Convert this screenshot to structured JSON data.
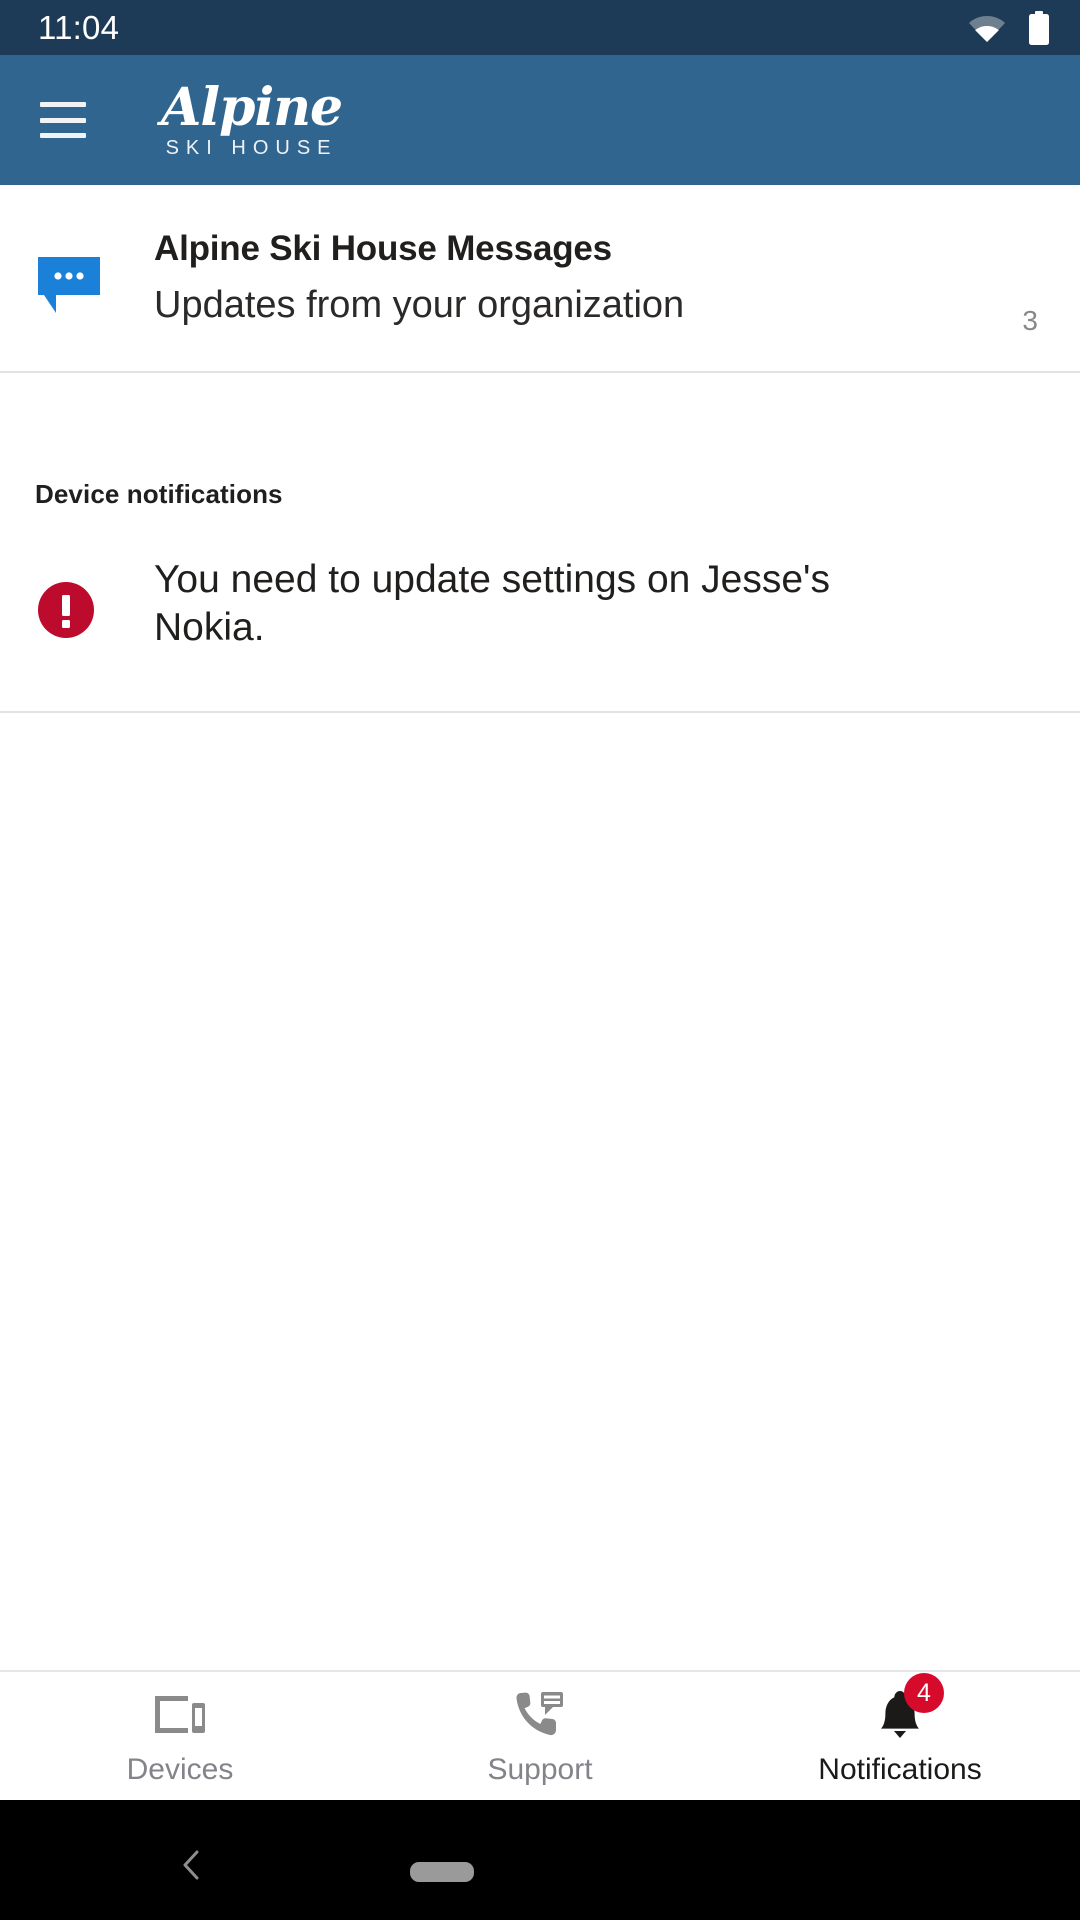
{
  "status_bar": {
    "clock": "11:04",
    "icons": [
      "wifi-icon",
      "battery-icon"
    ],
    "background_color": "#1d3b56"
  },
  "app_bar": {
    "menu_icon": "hamburger-menu-icon",
    "brand_name": "Alpine",
    "brand_subtitle": "SKI HOUSE",
    "background_color": "#30658f"
  },
  "messages_card": {
    "icon": "message-bubble-icon",
    "icon_color": "#1b81d8",
    "title": "Alpine Ski House Messages",
    "subtitle": "Updates from your organization",
    "count": "3"
  },
  "device_notifications": {
    "section_title": "Device notifications",
    "items": [
      {
        "icon": "alert-error-icon",
        "icon_color": "#bd0b2d",
        "text": "You need to update settings on Jesse's Nokia."
      }
    ]
  },
  "bottom_nav": {
    "tabs": [
      {
        "label": "Devices",
        "icon": "devices-tablet-phone-icon",
        "active": "false",
        "badge": ""
      },
      {
        "label": "Support",
        "icon": "support-phone-icon",
        "active": "false",
        "badge": ""
      },
      {
        "label": "Notifications",
        "icon": "bell-icon",
        "active": "true",
        "badge": "4"
      }
    ],
    "badge_color": "#d60b2b",
    "active_color": "#1b1a19",
    "inactive_color": "#84838a"
  },
  "system_nav": {
    "back_icon": "chevron-left-icon",
    "home_indicator": "home-pill-indicator",
    "background_color": "#000000"
  }
}
